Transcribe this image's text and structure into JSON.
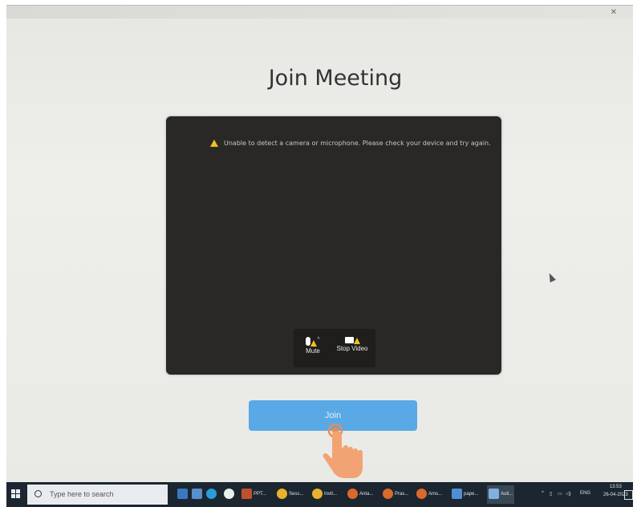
{
  "window": {
    "title": ""
  },
  "main": {
    "title": "Join Meeting",
    "warning": "Unable to detect a camera or microphone. Please check your device and try again.",
    "controls": {
      "mute": "Mute",
      "video": "Stop Video"
    },
    "join": "Join"
  },
  "taskbar": {
    "search_placeholder": "Type here to search",
    "apps": [
      {
        "label": "PPT...",
        "icon": "powerpoint-icon"
      },
      {
        "label": "Sess...",
        "icon": "chrome-icon"
      },
      {
        "label": "Invit...",
        "icon": "chrome-icon"
      },
      {
        "label": "Anta...",
        "icon": "chrome-icon"
      },
      {
        "label": "Pras...",
        "icon": "chrome-icon"
      },
      {
        "label": "Ams...",
        "icon": "chrome-icon"
      },
      {
        "label": "pape...",
        "icon": "image-icon"
      },
      {
        "label": "Auti...",
        "icon": "app-icon"
      }
    ],
    "tray": {
      "lang": "ENG",
      "time": "13:53",
      "date": "26-04-2023"
    }
  },
  "colors": {
    "join": "#58a9e6",
    "preview_bg": "#2a2827",
    "warning": "#f1c21b",
    "taskbar": "#1b2630"
  }
}
